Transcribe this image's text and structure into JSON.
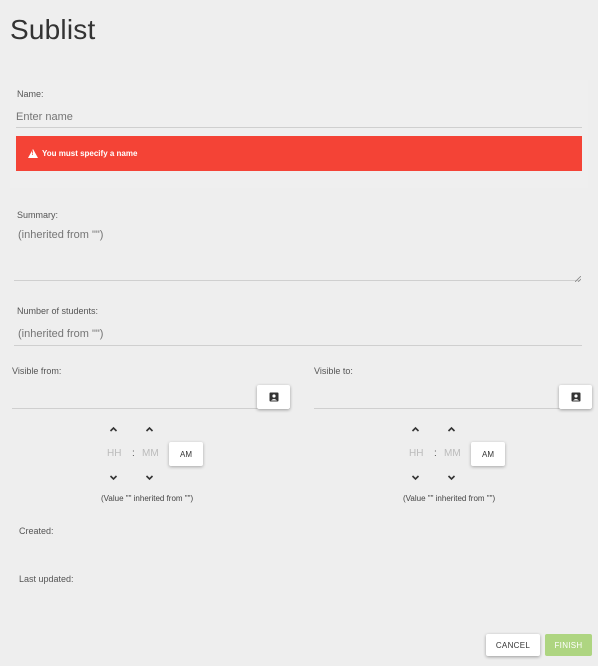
{
  "page": {
    "title": "Sublist"
  },
  "name_field": {
    "label": "Name:",
    "placeholder": "Enter name",
    "error": "You must specify a name"
  },
  "summary_field": {
    "label": "Summary:",
    "placeholder": "(inherited from \"\")"
  },
  "students_field": {
    "label": "Number of students:",
    "placeholder": "(inherited from \"\")"
  },
  "visible_from": {
    "label": "Visible from:",
    "hours_placeholder": "HH",
    "minutes_placeholder": "MM",
    "separator": ":",
    "ampm": "AM",
    "note": "(Value \"\" inherited from \"\")"
  },
  "visible_to": {
    "label": "Visible to:",
    "hours_placeholder": "HH",
    "minutes_placeholder": "MM",
    "separator": ":",
    "ampm": "AM",
    "note": "(Value \"\" inherited from \"\")"
  },
  "meta": {
    "created_label": "Created:",
    "updated_label": "Last updated:"
  },
  "actions": {
    "cancel_label": "CANCEL",
    "finish_label": "FINISH"
  },
  "colors": {
    "error": "#f44336",
    "finish_disabled": "#aed581",
    "background": "#eeeeee"
  },
  "icons": [
    "warning-icon",
    "calendar-icon",
    "chevron-up-icon",
    "chevron-down-icon",
    "resize-grip-icon"
  ]
}
